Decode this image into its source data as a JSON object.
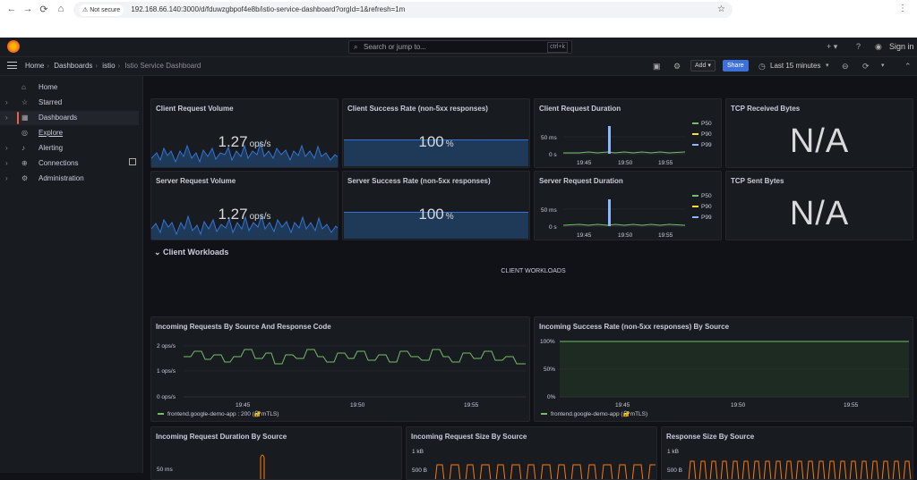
{
  "browser": {
    "not_secure": "Not secure",
    "url": "192.168.66.140:3000/d/fduwzgbpof4e8b/istio-service-dashboard?orgId=1&refresh=1m"
  },
  "topbar": {
    "search_placeholder": "Search or jump to...",
    "shortcut": "ctrl+k",
    "sign_in": "Sign in"
  },
  "breadcrumb": [
    "Home",
    "Dashboards",
    "istio",
    "Istio Service Dashboard"
  ],
  "toolbar": {
    "add": "Add",
    "share": "Share",
    "time_range": "Last 15 minutes"
  },
  "sidebar": {
    "items": [
      {
        "label": "Home",
        "icon": "home-icon"
      },
      {
        "label": "Starred",
        "icon": "star-icon"
      },
      {
        "label": "Dashboards",
        "icon": "grid-icon"
      },
      {
        "label": "Explore",
        "icon": "compass-icon"
      },
      {
        "label": "Alerting",
        "icon": "bell-icon"
      },
      {
        "label": "Connections",
        "icon": "plug-icon"
      },
      {
        "label": "Administration",
        "icon": "gear-icon"
      }
    ]
  },
  "panels": {
    "client_request_volume": {
      "title": "Client Request Volume",
      "value": "1.27",
      "unit": "ops/s"
    },
    "client_success_rate": {
      "title": "Client Success Rate (non-5xx responses)",
      "value": "100",
      "unit": "%"
    },
    "client_request_duration": {
      "title": "Client Request Duration",
      "ytick": "50 ms",
      "ytick0": "0 s",
      "xticks": [
        "19:45",
        "19:50",
        "19:55"
      ],
      "legend": [
        "P50",
        "P90",
        "P99"
      ]
    },
    "tcp_received": {
      "title": "TCP Received Bytes",
      "value": "N/A"
    },
    "server_request_volume": {
      "title": "Server Request Volume",
      "value": "1.27",
      "unit": "ops/s"
    },
    "server_success_rate": {
      "title": "Server Success Rate (non-5xx responses)",
      "value": "100",
      "unit": "%"
    },
    "server_request_duration": {
      "title": "Server Request Duration",
      "ytick": "50 ms",
      "ytick0": "0 s",
      "xticks": [
        "19:45",
        "19:50",
        "19:55"
      ],
      "legend": [
        "P50",
        "P90",
        "P99"
      ]
    },
    "tcp_sent": {
      "title": "TCP Sent Bytes",
      "value": "N/A"
    },
    "incoming_requests": {
      "title": "Incoming Requests By Source And Response Code",
      "yticks": [
        "2 ops/s",
        "1 ops/s",
        "0 ops/s"
      ],
      "xticks": [
        "19:45",
        "19:50",
        "19:55"
      ],
      "legend": "frontend.google-demo-app : 200 (🔐mTLS)"
    },
    "incoming_success": {
      "title": "Incoming Success Rate (non-5xx responses) By Source",
      "yticks": [
        "100%",
        "50%",
        "0%"
      ],
      "xticks": [
        "19:45",
        "19:50",
        "19:55"
      ],
      "legend": "frontend.google-demo-app (🔐mTLS)"
    },
    "incoming_duration": {
      "title": "Incoming Request Duration By Source",
      "ytick": "50 ms"
    },
    "incoming_size": {
      "title": "Incoming Request Size By Source",
      "yticks": [
        "1 kB",
        "500 B"
      ]
    },
    "response_size": {
      "title": "Response Size By Source",
      "yticks": [
        "1 kB",
        "500 B"
      ]
    }
  },
  "row": {
    "title": "Client Workloads",
    "text": "CLIENT WORKLOADS"
  },
  "colors": {
    "accent": "#f55f3e",
    "blue": "#3274d9",
    "green": "#73bf69",
    "yellow": "#fade2a",
    "orange": "#ff780a",
    "series_blue": "#8ab8ff"
  }
}
